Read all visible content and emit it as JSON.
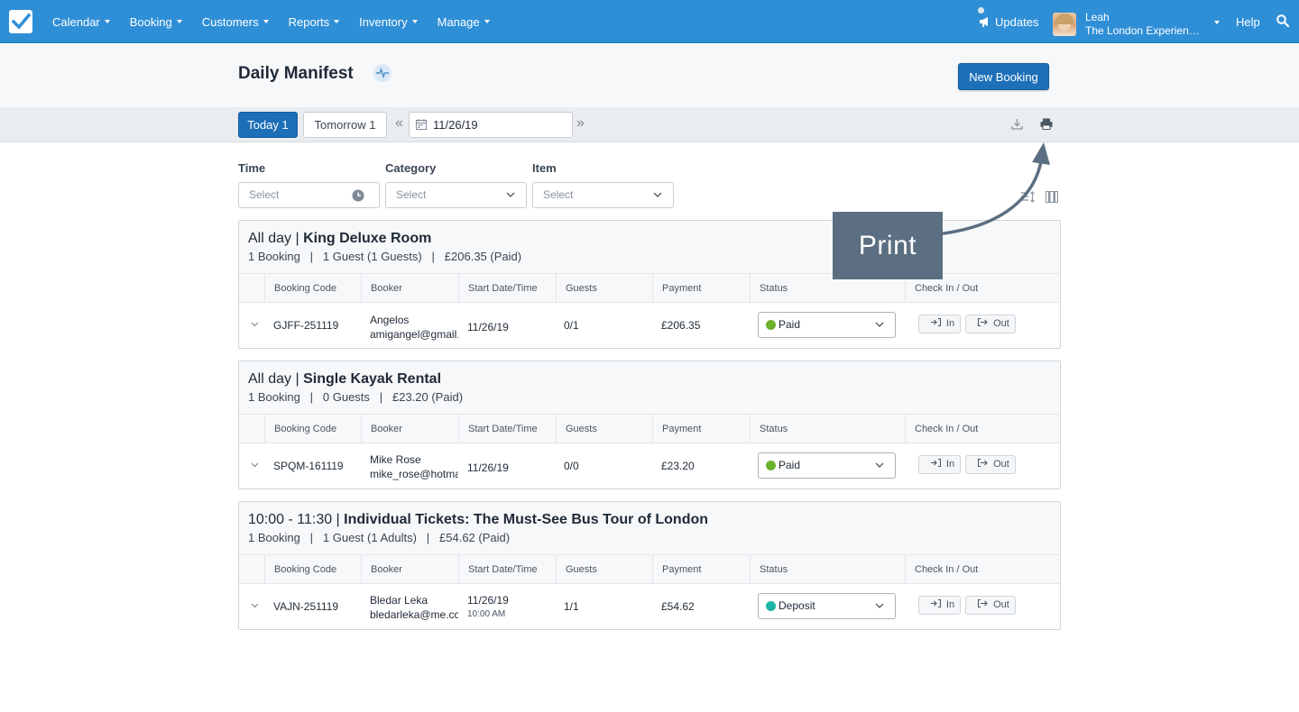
{
  "nav": {
    "items": [
      "Calendar",
      "Booking",
      "Customers",
      "Reports",
      "Inventory",
      "Manage"
    ],
    "updates_label": "Updates",
    "user_name": "Leah",
    "user_org": "The London Experience Ltd",
    "help_label": "Help"
  },
  "header": {
    "title": "Daily Manifest",
    "new_booking_label": "New Booking"
  },
  "toolbar": {
    "today_label": "Today 1",
    "tomorrow_label": "Tomorrow 1",
    "prev_label": "«",
    "next_label": "»",
    "date_value": "11/26/19"
  },
  "filters": {
    "time_label": "Time",
    "category_label": "Category",
    "item_label": "Item",
    "time_placeholder": "Select",
    "category_placeholder": "Select",
    "item_placeholder": "Select"
  },
  "columns": [
    "Booking Code",
    "Booker",
    "Start Date/Time",
    "Guests",
    "Payment",
    "Status",
    "Check In / Out"
  ],
  "checkin_label": "In",
  "checkout_label": "Out",
  "groups": [
    {
      "time": "All day",
      "name": "King Deluxe Room",
      "summary_bookings": "1 Booking",
      "summary_guests": "1 Guest (1 Guests)",
      "summary_payment": "£206.35 (Paid)",
      "row": {
        "code": "GJFF-251119",
        "booker_name": "Angelos",
        "booker_email": "amigangel@gmail.",
        "start_date": "11/26/19",
        "start_time": "",
        "guests": "0/1",
        "payment": "£206.35",
        "status": "Paid",
        "status_color": "#6cb22d"
      }
    },
    {
      "time": "All day",
      "name": "Single Kayak Rental",
      "summary_bookings": "1 Booking",
      "summary_guests": "0 Guests",
      "summary_payment": "£23.20 (Paid)",
      "row": {
        "code": "SPQM-161119",
        "booker_name": "Mike Rose",
        "booker_email": "mike_rose@hotma",
        "start_date": "11/26/19",
        "start_time": "",
        "guests": "0/0",
        "payment": "£23.20",
        "status": "Paid",
        "status_color": "#6cb22d"
      }
    },
    {
      "time": "10:00 - 11:30",
      "name": "Individual Tickets: The Must-See Bus Tour of London",
      "summary_bookings": "1 Booking",
      "summary_guests": "1 Guest (1 Adults)",
      "summary_payment": "£54.62 (Paid)",
      "row": {
        "code": "VAJN-251119",
        "booker_name": "Bledar Leka",
        "booker_email": "bledarleka@me.cc",
        "start_date": "11/26/19",
        "start_time": "10:00 AM",
        "guests": "1/1",
        "payment": "£54.62",
        "status": "Deposit",
        "status_color": "#1fb5a6"
      }
    }
  ],
  "annotation": {
    "label": "Print"
  }
}
